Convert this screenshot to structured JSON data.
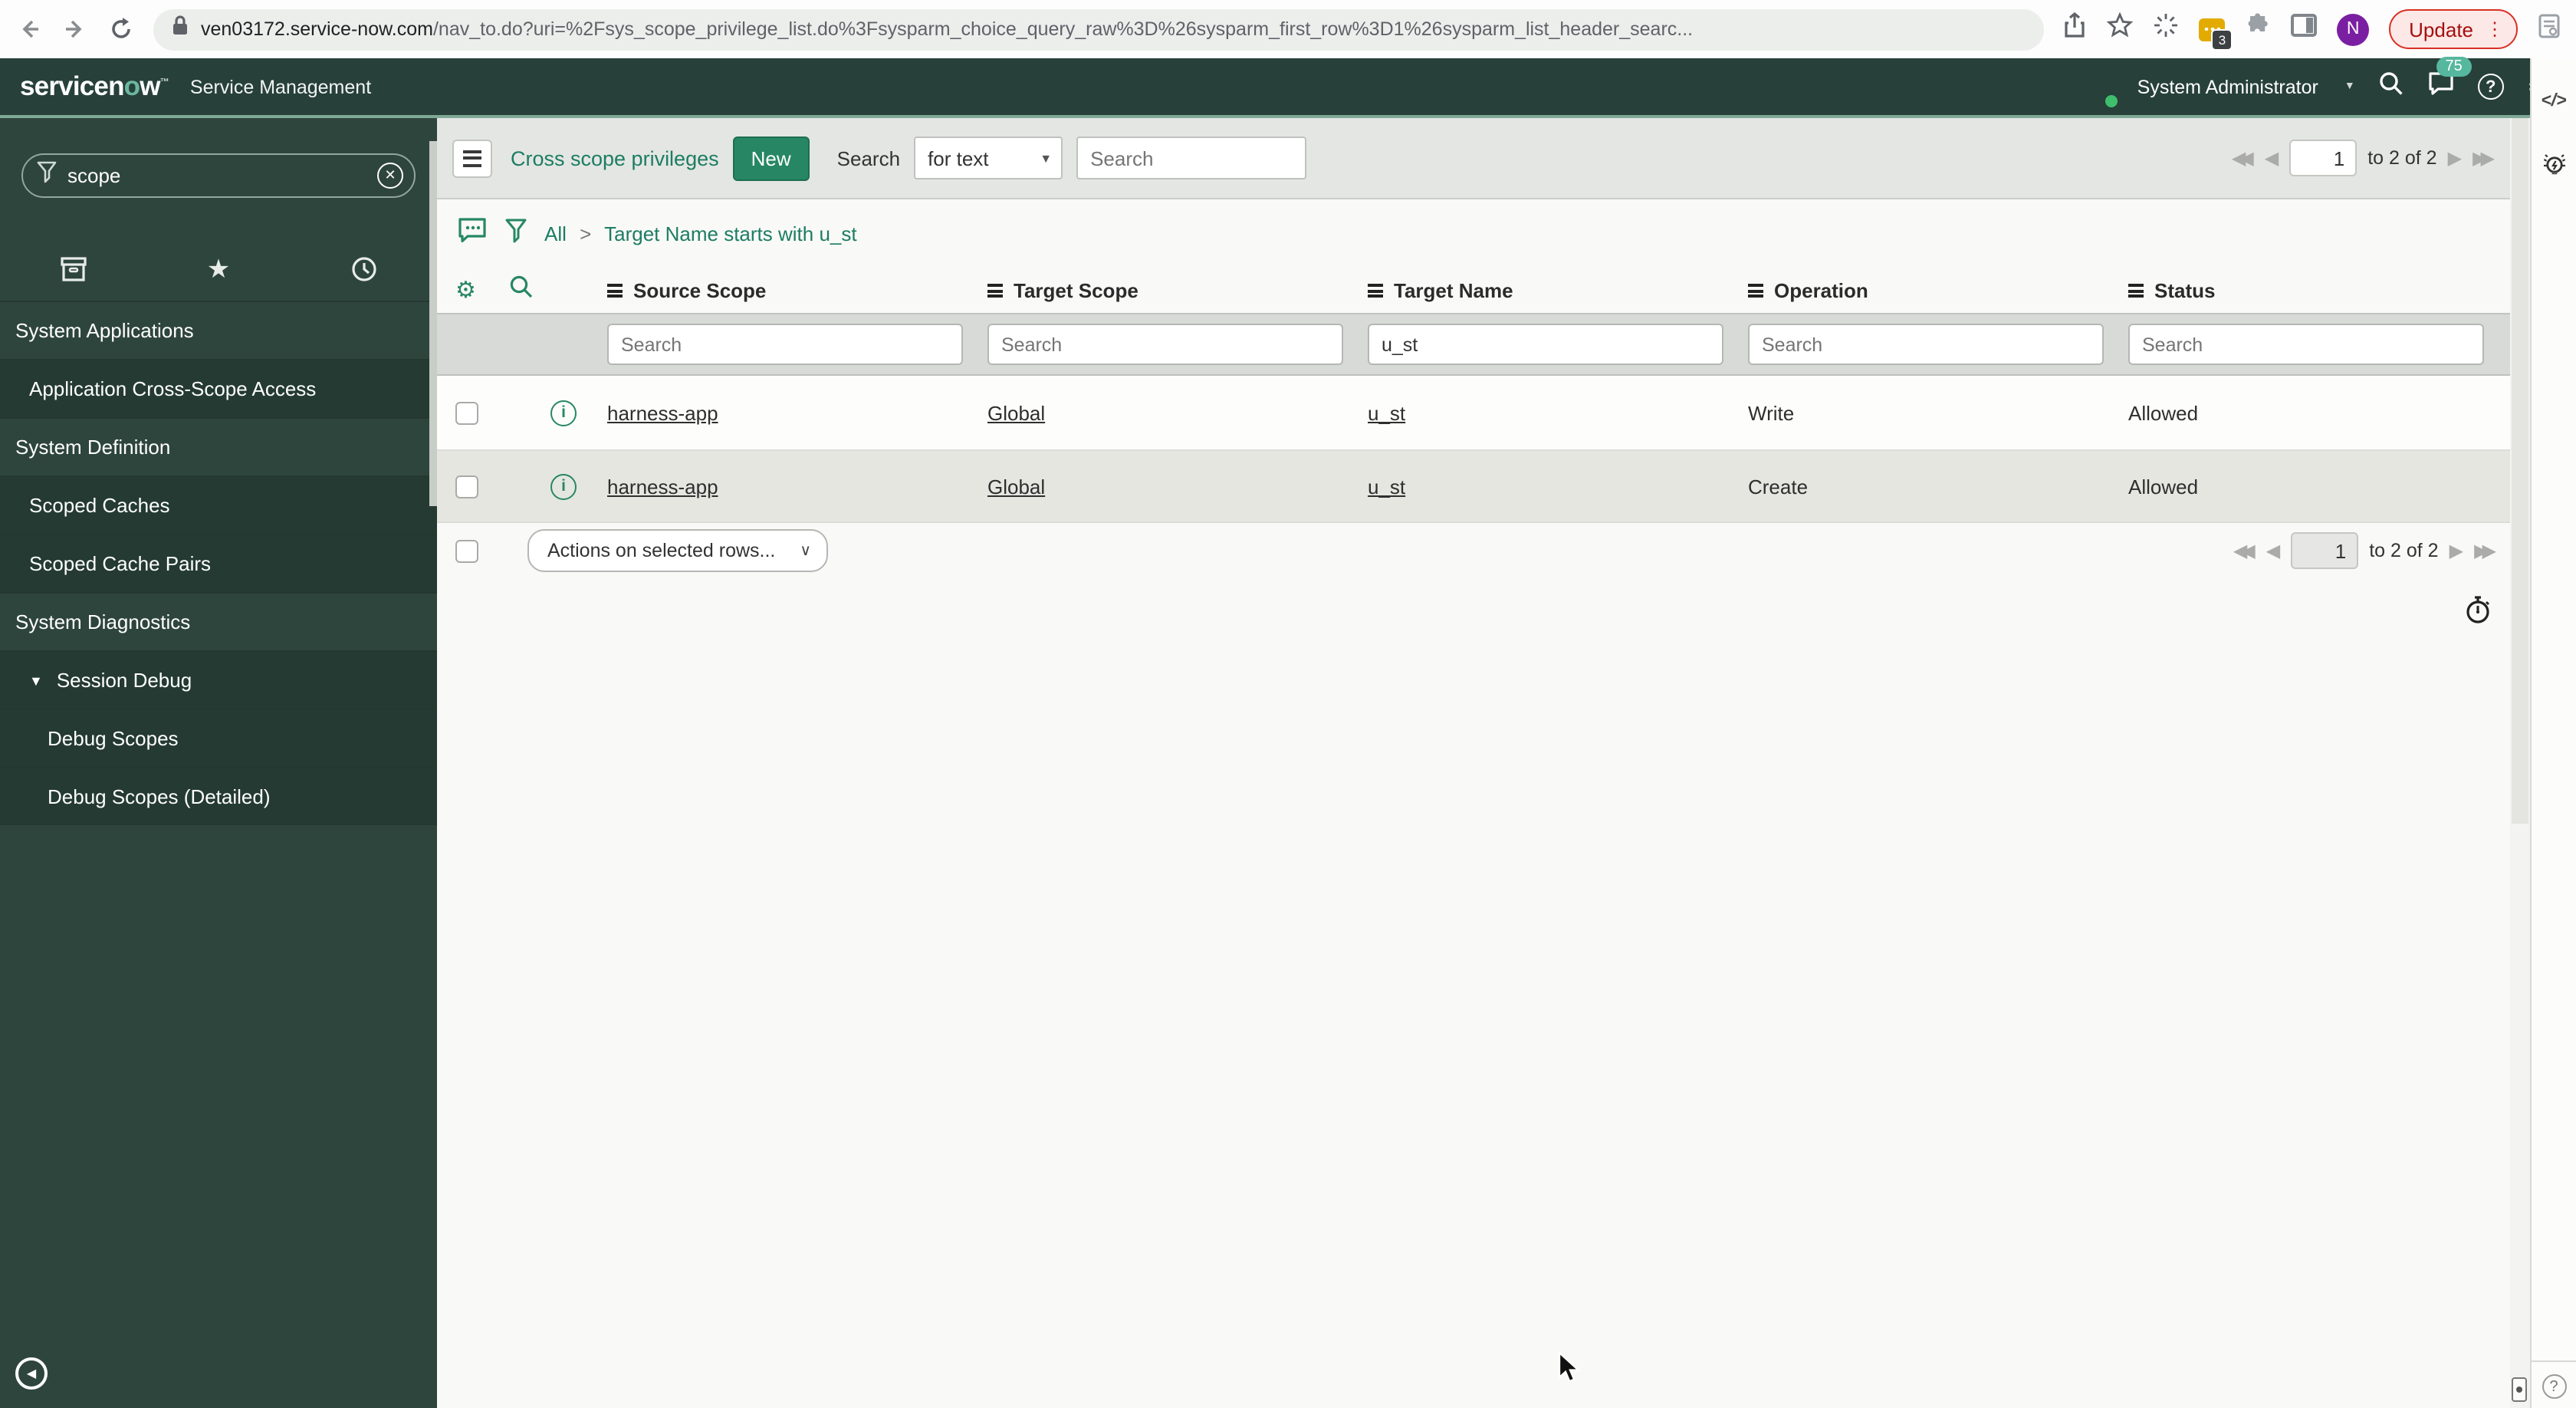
{
  "browser": {
    "url_domain": "ven03172.service-now.com",
    "url_path": "/nav_to.do?uri=%2Fsys_scope_privilege_list.do%3Fsysparm_choice_query_raw%3D%26sysparm_first_row%3D1%26sysparm_list_header_searc...",
    "update_label": "Update",
    "extension_badge": "3",
    "profile_initial": "N"
  },
  "header": {
    "logo_pre": "servicen",
    "logo_o": "o",
    "logo_post": "w",
    "logo_tm": "™",
    "product": "Service Management",
    "user": "System Administrator",
    "notification_count": "75"
  },
  "sidebar": {
    "filter_value": "scope",
    "items": [
      {
        "label": "System Applications"
      },
      {
        "label": "Application Cross-Scope Access"
      },
      {
        "label": "System Definition"
      },
      {
        "label": "Scoped Caches"
      },
      {
        "label": "Scoped Cache Pairs"
      },
      {
        "label": "System Diagnostics"
      },
      {
        "label": "Session Debug"
      },
      {
        "label": "Debug Scopes"
      },
      {
        "label": "Debug Scopes (Detailed)"
      }
    ]
  },
  "toolbar": {
    "title": "Cross scope privileges",
    "new_label": "New",
    "search_label": "Search",
    "search_type": "for text",
    "search_placeholder": "Search"
  },
  "breadcrumb": {
    "root": "All",
    "separator": ">",
    "current": "Target Name starts with u_st"
  },
  "table": {
    "columns": [
      "Source Scope",
      "Target Scope",
      "Target Name",
      "Operation",
      "Status"
    ],
    "filter_placeholder": "Search",
    "filter_target_name": "u_st",
    "rows": [
      {
        "source_scope": "harness-app",
        "target_scope": "Global",
        "target_name": "u_st",
        "operation": "Write",
        "status": "Allowed"
      },
      {
        "source_scope": "harness-app",
        "target_scope": "Global",
        "target_name": "u_st",
        "operation": "Create",
        "status": "Allowed"
      }
    ]
  },
  "actions": {
    "label": "Actions on selected rows..."
  },
  "pagination": {
    "page": "1",
    "range_label": "to 2 of 2"
  },
  "colors": {
    "brand_header_green": "#27403a",
    "accent_teal_button": "#278764",
    "link_teal": "#1c7d63",
    "notification_badge_teal": "#56b79f",
    "update_red": "#d93025",
    "extension_yellow": "#e3ab00",
    "profile_purple": "#7b1fa2"
  }
}
